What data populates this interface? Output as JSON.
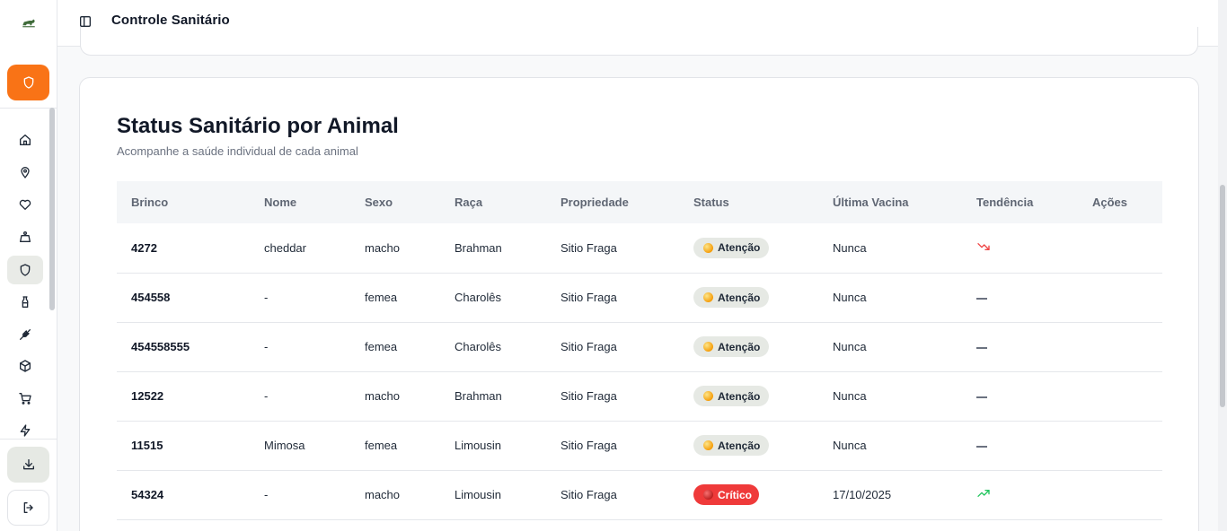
{
  "header": {
    "title": "Controle Sanitário"
  },
  "sidebar": {
    "items": [
      {
        "icon": "home-icon"
      },
      {
        "icon": "map-pin-icon"
      },
      {
        "icon": "heart-icon"
      },
      {
        "icon": "weight-icon"
      },
      {
        "icon": "shield-icon"
      },
      {
        "icon": "milk-bottle-icon"
      },
      {
        "icon": "wheat-icon"
      },
      {
        "icon": "package-icon"
      },
      {
        "icon": "cart-icon"
      },
      {
        "icon": "zap-icon"
      }
    ],
    "active_index": 4
  },
  "card": {
    "title": "Status Sanitário por Animal",
    "subtitle": "Acompanhe a saúde individual de cada animal"
  },
  "table": {
    "headers": [
      "Brinco",
      "Nome",
      "Sexo",
      "Raça",
      "Propriedade",
      "Status",
      "Última Vacina",
      "Tendência",
      "Ações"
    ],
    "rows": [
      {
        "brinco": "4272",
        "nome": "cheddar",
        "sexo": "macho",
        "raca": "Brahman",
        "propriedade": "Sitio Fraga",
        "status": "Atenção",
        "ultima_vacina": "Nunca",
        "tendencia": "down"
      },
      {
        "brinco": "454558",
        "nome": "-",
        "sexo": "femea",
        "raca": "Charolês",
        "propriedade": "Sitio Fraga",
        "status": "Atenção",
        "ultima_vacina": "Nunca",
        "tendencia": "flat"
      },
      {
        "brinco": "454558555",
        "nome": "-",
        "sexo": "femea",
        "raca": "Charolês",
        "propriedade": "Sitio Fraga",
        "status": "Atenção",
        "ultima_vacina": "Nunca",
        "tendencia": "flat"
      },
      {
        "brinco": "12522",
        "nome": "-",
        "sexo": "macho",
        "raca": "Brahman",
        "propriedade": "Sitio Fraga",
        "status": "Atenção",
        "ultima_vacina": "Nunca",
        "tendencia": "flat"
      },
      {
        "brinco": "11515",
        "nome": "Mimosa",
        "sexo": "femea",
        "raca": "Limousin",
        "propriedade": "Sitio Fraga",
        "status": "Atenção",
        "ultima_vacina": "Nunca",
        "tendencia": "flat"
      },
      {
        "brinco": "54324",
        "nome": "-",
        "sexo": "macho",
        "raca": "Limousin",
        "propriedade": "Sitio Fraga",
        "status": "Crítico",
        "ultima_vacina": "17/10/2025",
        "tendencia": "up"
      }
    ]
  },
  "colors": {
    "accent": "#f97316",
    "critical": "#ef3a3a",
    "warning": "#f59e0b",
    "trend_up": "#22c55e",
    "trend_down": "#ef4444"
  }
}
